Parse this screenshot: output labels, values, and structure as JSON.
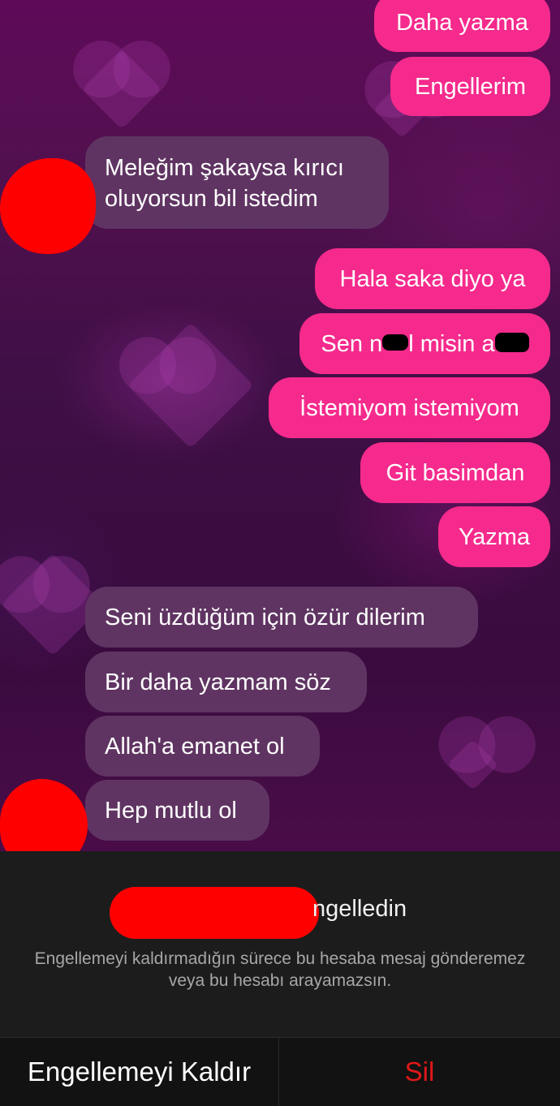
{
  "messages": {
    "sent_top": [
      "Daha yazma",
      "Engellerim"
    ],
    "recv_1": "Meleğim şakaysa kırıcı oluyorsun bil istedim",
    "sent_mid": {
      "m1": "Hala saka diyo ya",
      "m2_a": "Sen n",
      "m2_b": "l misin a",
      "m3": "İstemiyom istemiyom",
      "m4": "Git basimdan",
      "m5": "Yazma"
    },
    "recv_2": [
      "Seni üzdüğüm için özür dilerim",
      "Bir daha yazmam söz",
      "Allah'a emanet ol",
      "Hep mutlu ol"
    ]
  },
  "blocked": {
    "title": "ngelledin",
    "description": "Engellemeyi kaldırmadığın sürece bu hesaba mesaj gönderemez veya bu hesabı arayamazsın."
  },
  "actions": {
    "unblock": "Engellemeyi Kaldır",
    "delete": "Sil"
  },
  "colors": {
    "sent_bubble": "#f52a8c",
    "recv_bubble": "#5f3462",
    "delete_text": "#e01818"
  }
}
